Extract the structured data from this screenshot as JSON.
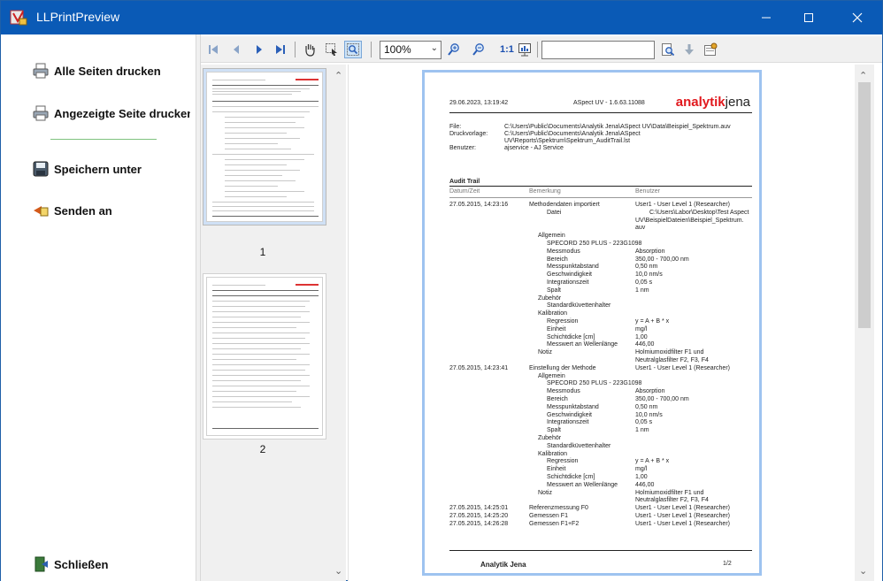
{
  "window": {
    "title": "LLPrintPreview"
  },
  "actions": {
    "print_all": "Alle Seiten drucken",
    "print_shown": "Angezeigte Seite drucken",
    "save_as": "Speichern unter",
    "send_to": "Senden an",
    "close": "Schließen"
  },
  "toolbar": {
    "zoom": "100%",
    "ratio": "1:1",
    "search_value": ""
  },
  "thumbnails": [
    {
      "label": "1"
    },
    {
      "label": "2"
    }
  ],
  "page": {
    "header_date": "29.06.2023, 13:19:42",
    "header_app": "ASpect UV - 1.6.63.11088",
    "logo_bold": "analytik",
    "logo_rest": "jena",
    "meta": [
      {
        "label": "File:",
        "value": "C:\\Users\\Public\\Documents\\Analytik Jena\\ASpect  UV\\Data\\Beispiel_Spektrum.auv"
      },
      {
        "label": "Druckvorlage:",
        "value": "C:\\Users\\Public\\Documents\\Analytik Jena\\ASpect"
      },
      {
        "label": "",
        "value": "UV\\Reports\\Spektrum\\Spektrum_AuditTrail.lst"
      },
      {
        "label": "Benutzer:",
        "value": "ajservice - AJ Service"
      }
    ],
    "audit_title": "Audit Trail",
    "columns": [
      "Datum/Zeit",
      "Bemerkung",
      "Benutzer"
    ],
    "rows": [
      {
        "d": "27.05.2015, 14:23:16",
        "b": "Methodendaten importiert",
        "u": "User1 - User Level 1 (Researcher)",
        "i": 0
      },
      {
        "d": "",
        "b": "Datei",
        "u": "C:\\Users\\Labor\\Desktop\\Test Aspect",
        "i": 2
      },
      {
        "d": "",
        "b": "",
        "u": "UV\\BeispielDateien\\Beispiel_Spektrum.",
        "i": 0
      },
      {
        "d": "",
        "b": "",
        "u": "auv",
        "i": 0
      },
      {
        "d": "",
        "b": "Allgemein",
        "u": "",
        "i": 1
      },
      {
        "d": "",
        "b": "SPECORD 250 PLUS - 223G1098",
        "u": "",
        "i": 2
      },
      {
        "d": "",
        "b": "Messmodus",
        "u": "Absorption",
        "i": 2
      },
      {
        "d": "",
        "b": "Bereich",
        "u": "350,00 - 700,00 nm",
        "i": 2
      },
      {
        "d": "",
        "b": "Messpunktabstand",
        "u": "0,50 nm",
        "i": 2
      },
      {
        "d": "",
        "b": "Geschwindigkeit",
        "u": "10,0 nm/s",
        "i": 2
      },
      {
        "d": "",
        "b": "Integrationszeit",
        "u": "0,05 s",
        "i": 2
      },
      {
        "d": "",
        "b": "Spalt",
        "u": "1 nm",
        "i": 2
      },
      {
        "d": "",
        "b": "Zubehör",
        "u": "",
        "i": 1
      },
      {
        "d": "",
        "b": "Standardküvettenhalter",
        "u": "",
        "i": 2
      },
      {
        "d": "",
        "b": "Kalibration",
        "u": "",
        "i": 1
      },
      {
        "d": "",
        "b": "Regression",
        "u": "y = A + B * x",
        "i": 2
      },
      {
        "d": "",
        "b": "Einheit",
        "u": "mg/l",
        "i": 2
      },
      {
        "d": "",
        "b": "Schichtdicke [cm]",
        "u": "1,00",
        "i": 2
      },
      {
        "d": "",
        "b": "Messwert an Wellenlänge",
        "u": "446,00",
        "i": 2
      },
      {
        "d": "",
        "b": "Notiz",
        "u": "Holmiumoxidfilter F1 und",
        "i": 1
      },
      {
        "d": "",
        "b": "",
        "u": "Neutralglasfilter F2, F3, F4",
        "i": 0
      },
      {
        "d": "27.05.2015, 14:23:41",
        "b": "Einstellung der Methode",
        "u": "User1 - User Level 1 (Researcher)",
        "i": 0
      },
      {
        "d": "",
        "b": "Allgemein",
        "u": "",
        "i": 1
      },
      {
        "d": "",
        "b": "SPECORD 250 PLUS - 223G1098",
        "u": "",
        "i": 2
      },
      {
        "d": "",
        "b": "Messmodus",
        "u": "Absorption",
        "i": 2
      },
      {
        "d": "",
        "b": "Bereich",
        "u": "350,00 - 700,00 nm",
        "i": 2
      },
      {
        "d": "",
        "b": "Messpunktabstand",
        "u": "0,50 nm",
        "i": 2
      },
      {
        "d": "",
        "b": "Geschwindigkeit",
        "u": "10,0 nm/s",
        "i": 2
      },
      {
        "d": "",
        "b": "Integrationszeit",
        "u": "0,05 s",
        "i": 2
      },
      {
        "d": "",
        "b": "Spalt",
        "u": "1 nm",
        "i": 2
      },
      {
        "d": "",
        "b": "Zubehör",
        "u": "",
        "i": 1
      },
      {
        "d": "",
        "b": "Standardküvettenhalter",
        "u": "",
        "i": 2
      },
      {
        "d": "",
        "b": "Kalibration",
        "u": "",
        "i": 1
      },
      {
        "d": "",
        "b": "Regression",
        "u": "y = A + B * x",
        "i": 2
      },
      {
        "d": "",
        "b": "Einheit",
        "u": "mg/l",
        "i": 2
      },
      {
        "d": "",
        "b": "Schichtdicke [cm]",
        "u": "1,00",
        "i": 2
      },
      {
        "d": "",
        "b": "Messwert an Wellenlänge",
        "u": "446,00",
        "i": 2
      },
      {
        "d": "",
        "b": "Notiz",
        "u": "Holmiumoxidfilter F1 und",
        "i": 1
      },
      {
        "d": "",
        "b": "",
        "u": "Neutralglasfilter F2, F3, F4",
        "i": 0
      },
      {
        "d": "27.05.2015, 14:25:01",
        "b": "Referenzmessung F0",
        "u": "User1 - User Level 1 (Researcher)",
        "i": 0
      },
      {
        "d": "27.05.2015, 14:25:20",
        "b": "Gemessen F1",
        "u": "User1 - User Level 1 (Researcher)",
        "i": 0
      },
      {
        "d": "27.05.2015, 14:26:28",
        "b": "Gemessen F1+F2",
        "u": "User1 - User Level 1 (Researcher)",
        "i": 0
      }
    ],
    "footer_name": "Analytik Jena",
    "footer_page": "1/2"
  },
  "colors": {
    "titlebar": "#0a5ab6",
    "logo_red": "#e1191e",
    "active_border": "#9ec3f0"
  }
}
